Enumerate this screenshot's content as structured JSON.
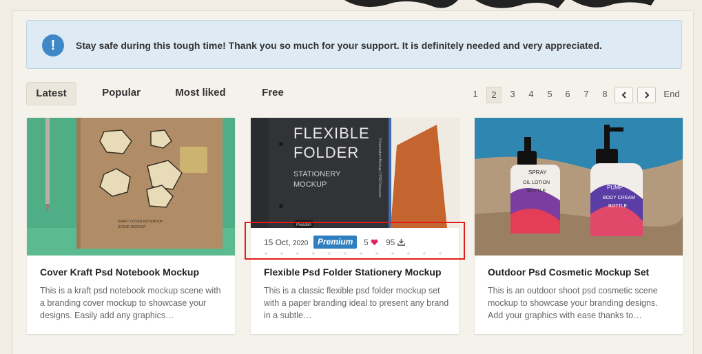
{
  "notice": {
    "icon": "exclamation-icon",
    "text": "Stay safe during this tough time! Thank you so much for your support. It is definitely needed and very appreciated."
  },
  "tabs": [
    {
      "label": "Latest",
      "active": true
    },
    {
      "label": "Popular",
      "active": false
    },
    {
      "label": "Most liked",
      "active": false
    },
    {
      "label": "Free",
      "active": false
    }
  ],
  "pagination": {
    "pages": [
      "1",
      "2",
      "3",
      "4",
      "5",
      "6",
      "7",
      "8"
    ],
    "current": "2",
    "prev_icon": "chevron-left-icon",
    "next_icon": "chevron-right-icon",
    "end_label": "End"
  },
  "cards": [
    {
      "title": "Cover Kraft Psd Notebook Mockup",
      "description": "This is a kraft psd notebook mockup scene with a branding cover mockup to showcase your designs. Easily add any graphics…",
      "image_text": [
        "KRAFT COVER NOTEBOOK",
        "SCENE MOCKUP"
      ]
    },
    {
      "title": "Flexible Psd Folder Stationery Mockup",
      "description": "This is a classic flexible psd folder mockup set with a paper branding ideal to present any brand in a subtle…",
      "image_text": [
        "FLEXIBLE",
        "FOLDER",
        "STATIONERY",
        "MOCKUP",
        "Pixeden",
        "Presentation Mockup // PSD Resource"
      ],
      "meta": {
        "date": "15 Oct,",
        "year": "2020",
        "badge": "Premium",
        "likes": "5",
        "downloads": "95"
      }
    },
    {
      "title": "Outdoor Psd Cosmetic Mockup Set",
      "description": "This is an outdoor shoot psd cosmetic scene mockup to showcase your branding designs. Add your graphics with ease thanks to…",
      "image_text": [
        "SPRAY",
        "OIL LOTION",
        "BOTTLE",
        "PUMP",
        "BODY CREAM",
        "BOTTLE"
      ]
    }
  ],
  "colors": {
    "accent": "#2f7fc0",
    "highlight": "#e11b1b",
    "heart": "#e0245e"
  }
}
